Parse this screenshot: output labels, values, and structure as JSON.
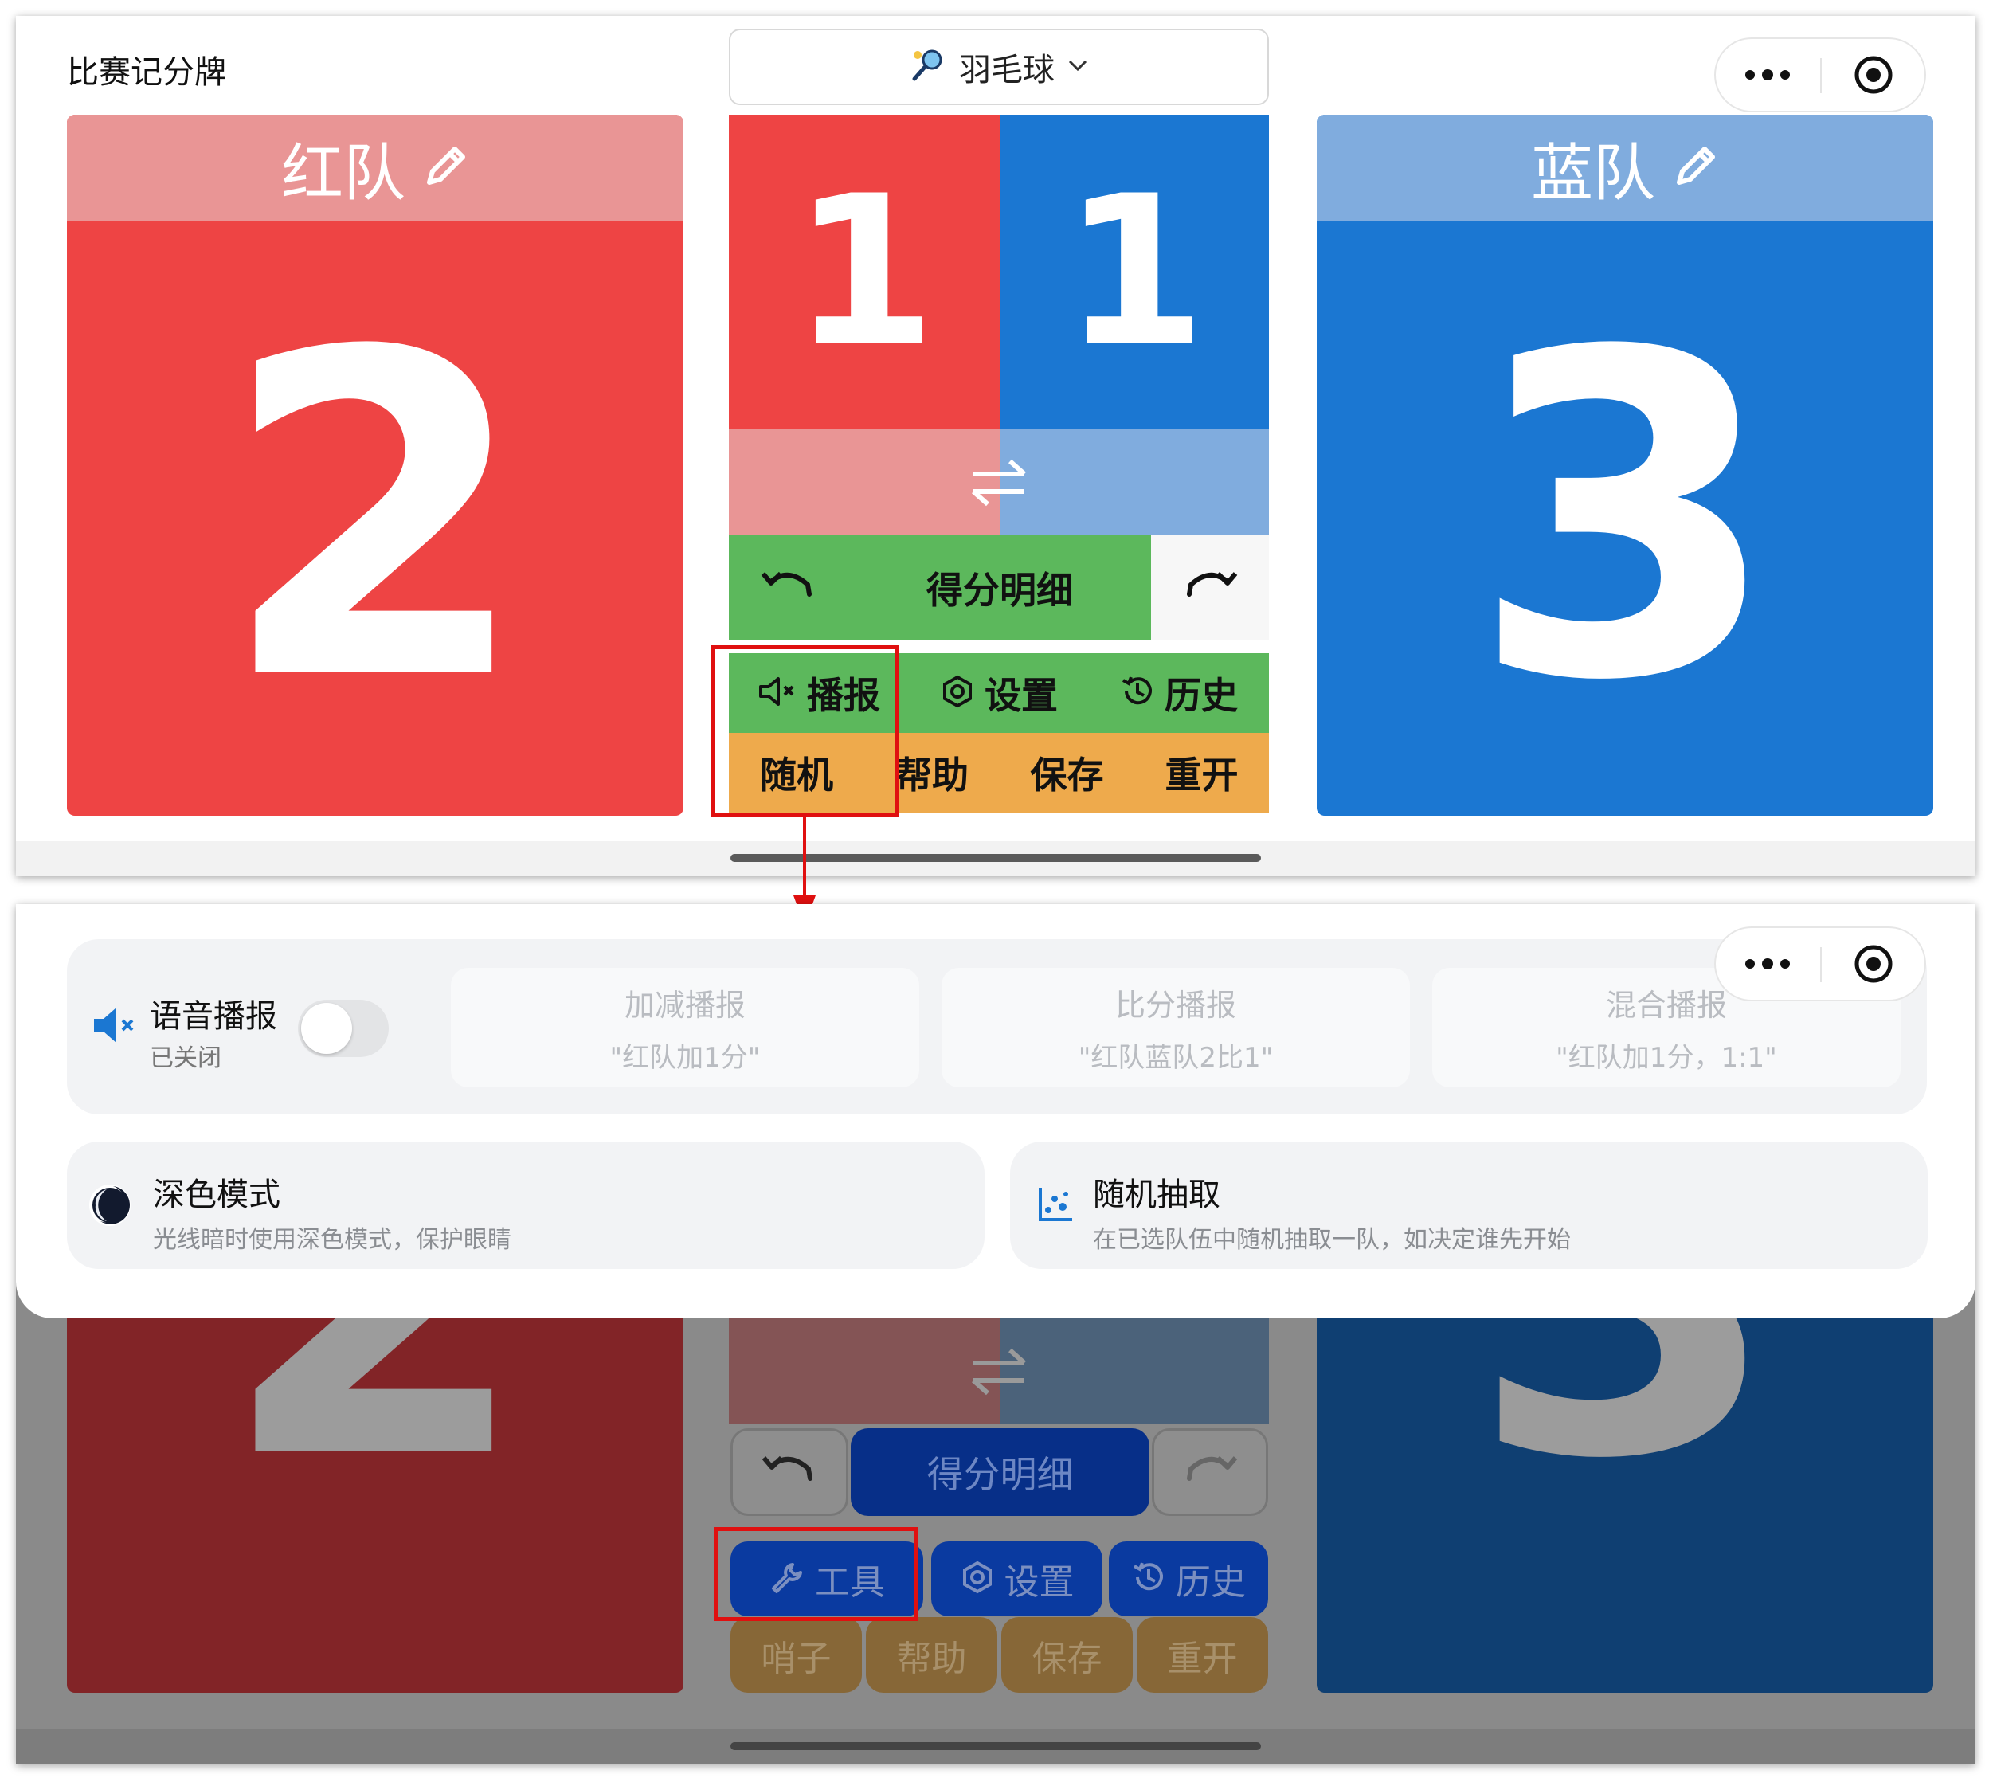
{
  "app": {
    "title": "比赛记分牌",
    "sport": "羽毛球"
  },
  "teams": {
    "red": {
      "name": "红队",
      "score": "2",
      "game_wins": "1"
    },
    "blue": {
      "name": "蓝队",
      "score": "3",
      "game_wins": "1"
    }
  },
  "controls": {
    "detail": "得分明细",
    "row1": [
      "播报",
      "设置",
      "历史"
    ],
    "row2": [
      "随机",
      "帮助",
      "保存",
      "重开"
    ]
  },
  "lower_controls": {
    "detail": "得分明细",
    "row1": [
      "工具",
      "设置",
      "历史"
    ],
    "row2": [
      "哨子",
      "帮助",
      "保存",
      "重开"
    ]
  },
  "sheet": {
    "voice": {
      "label": "语音播报",
      "status": "已关闭"
    },
    "broadcast_options": [
      {
        "title": "加减播报",
        "sample": "\"红队加1分\""
      },
      {
        "title": "比分播报",
        "sample": "\"红队蓝队2比1\""
      },
      {
        "title": "混合播报",
        "sample": "\"红队加1分，1:1\""
      }
    ],
    "dark_mode": {
      "title": "深色模式",
      "desc": "光线暗时使用深色模式，保护眼睛"
    },
    "random_pick": {
      "title": "随机抽取",
      "desc": "在已选队伍中随机抽取一队，如决定谁先开始"
    }
  },
  "icons": [
    "badminton-icon",
    "chevron-down-icon",
    "more-icon",
    "record-icon",
    "pencil-icon",
    "swap-icon",
    "undo-icon",
    "redo-icon",
    "mute-icon",
    "gear-icon",
    "history-icon",
    "wrench-icon",
    "speaker-mute-icon",
    "moon-icon",
    "scatter-icon"
  ],
  "colors": {
    "red": "#ee4444",
    "red_light": "#e99595",
    "blue": "#1b77d2",
    "blue_light": "#80acde",
    "green": "#5cb85c",
    "orange": "#eeaa4c",
    "annotation": "#e01010"
  }
}
